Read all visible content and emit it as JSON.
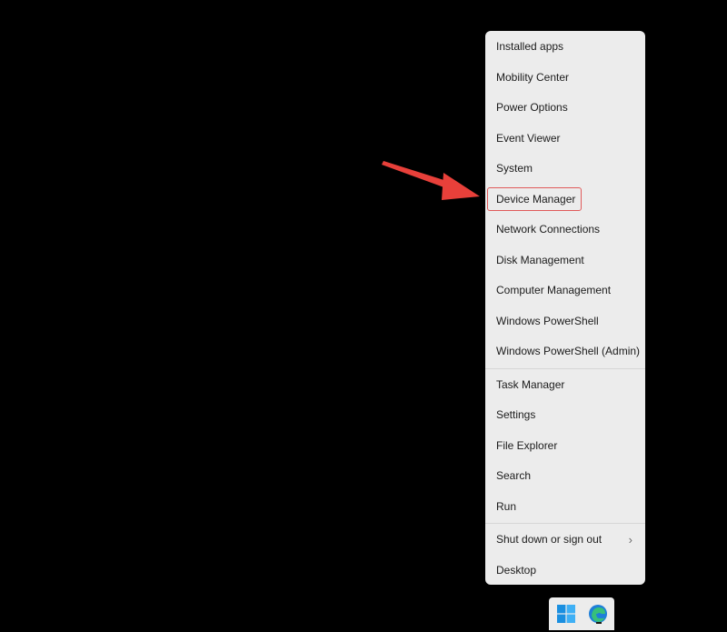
{
  "menu": {
    "groups": [
      {
        "items": [
          {
            "label": "Installed apps"
          },
          {
            "label": "Mobility Center"
          },
          {
            "label": "Power Options"
          },
          {
            "label": "Event Viewer"
          },
          {
            "label": "System"
          },
          {
            "label": "Device Manager",
            "highlighted": true
          },
          {
            "label": "Network Connections"
          },
          {
            "label": "Disk Management"
          },
          {
            "label": "Computer Management"
          },
          {
            "label": "Windows PowerShell"
          },
          {
            "label": "Windows PowerShell (Admin)"
          }
        ]
      },
      {
        "items": [
          {
            "label": "Task Manager"
          },
          {
            "label": "Settings"
          },
          {
            "label": "File Explorer"
          },
          {
            "label": "Search"
          },
          {
            "label": "Run"
          }
        ]
      },
      {
        "items": [
          {
            "label": "Shut down or sign out",
            "submenu": true
          },
          {
            "label": "Desktop"
          }
        ]
      }
    ],
    "submenu_glyph": "›"
  },
  "annotation": {
    "arrow_color": "#e8403a",
    "highlight_color": "#e05a5a"
  },
  "taskbar": {
    "icons": [
      "windows-start-icon",
      "edge-browser-icon"
    ],
    "start_colors": [
      "#1a8fe0",
      "#3fb0f5"
    ]
  }
}
